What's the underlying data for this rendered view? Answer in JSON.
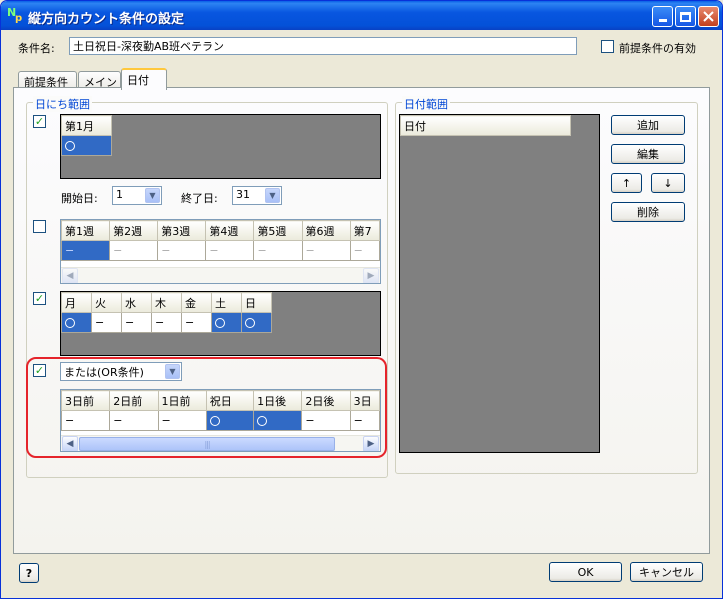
{
  "window": {
    "title": "縦方向カウント条件の設定",
    "icon_n": "N",
    "icon_p": "p"
  },
  "condition": {
    "name_label": "条件名:",
    "name_value": "土日祝日-深夜勤AB班ベテラン",
    "prereq_enabled_label": "前提条件の有効",
    "prereq_enabled": false
  },
  "tabs": [
    {
      "label": "前提条件",
      "active": false
    },
    {
      "label": "メイン",
      "active": false
    },
    {
      "label": "日付",
      "active": true
    }
  ],
  "day_range": {
    "title": "日にち範囲",
    "month": {
      "checked": true,
      "header": "第1月",
      "value": "○"
    },
    "start_label": "開始日:",
    "start_value": "1",
    "end_label": "終了日:",
    "end_value": "31",
    "weeks": {
      "checked": false,
      "headers": [
        "第1週",
        "第2週",
        "第3週",
        "第4週",
        "第5週",
        "第6週",
        "第7"
      ],
      "values": [
        "−",
        "−",
        "−",
        "−",
        "−",
        "−",
        "−"
      ]
    },
    "weekdays": {
      "checked": true,
      "headers": [
        "月",
        "火",
        "水",
        "木",
        "金",
        "土",
        "日"
      ],
      "values": [
        "○",
        "−",
        "−",
        "−",
        "−",
        "○",
        "○"
      ]
    },
    "holidays": {
      "checked": true,
      "mode_value": "または(OR条件)",
      "headers": [
        "3日前",
        "2日前",
        "1日前",
        "祝日",
        "1日後",
        "2日後",
        "3日"
      ],
      "values": [
        "−",
        "−",
        "−",
        "○",
        "○",
        "−",
        "−"
      ]
    }
  },
  "date_range": {
    "title": "日付範囲",
    "column_header": "日付"
  },
  "buttons": {
    "add": "追加",
    "edit": "編集",
    "up": "↑",
    "down": "↓",
    "delete": "削除",
    "help": "?",
    "ok": "OK",
    "cancel": "キャンセル"
  }
}
